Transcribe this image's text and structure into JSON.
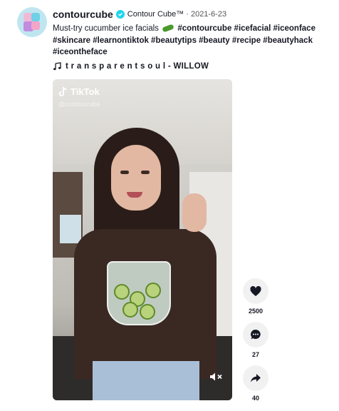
{
  "post": {
    "username": "contourcube",
    "nickname": "Contour Cube™",
    "separator": "·",
    "date": "2021-6-23",
    "caption_text": "Must-try cucumber ice facials",
    "hashtags_line1": "#contourcube #icefacial #iceonface",
    "hashtags_line2": "#skincare #learnontiktok #beautytips #beauty #recipe #beautyhack",
    "hashtags_line3": "#iceontheface",
    "music": "t r a n s p a r e n t s o u l - WILLOW"
  },
  "video": {
    "watermark_brand": "TikTok",
    "watermark_handle": "@contourcube"
  },
  "actions": {
    "likes": "2500",
    "comments": "27",
    "shares": "40"
  },
  "icons": {
    "verified": "verified-badge-icon",
    "music": "music-note-icon",
    "like": "heart-icon",
    "comment": "comment-icon",
    "share": "share-arrow-icon",
    "mute": "muted-speaker-icon",
    "tiktok": "tiktok-logo-icon"
  },
  "colors": {
    "verified": "#20d5ec",
    "text": "#161823",
    "action_bg": "#f1f1f2"
  }
}
